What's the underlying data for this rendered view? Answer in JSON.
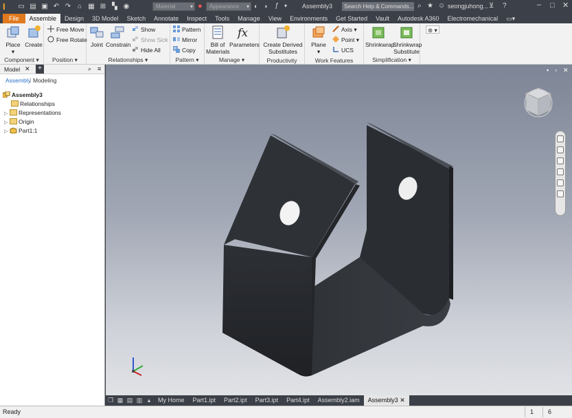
{
  "titlebar": {
    "material_placeholder": "Material",
    "appearance_placeholder": "Appearance",
    "document_title": "Assembly3",
    "search_placeholder": "Search Help & Commands...",
    "user": "seongjuhong..."
  },
  "tabs": [
    "File",
    "Assemble",
    "Design",
    "3D Model",
    "Sketch",
    "Annotate",
    "Inspect",
    "Tools",
    "Manage",
    "View",
    "Environments",
    "Get Started",
    "Vault",
    "Autodesk A360",
    "Electromechanical"
  ],
  "ribbon": {
    "component": {
      "place": "Place",
      "create": "Create",
      "label": "Component"
    },
    "position": {
      "free_move": "Free Move",
      "free_rotate": "Free Rotate",
      "label": "Position"
    },
    "relationships": {
      "joint": "Joint",
      "constrain": "Constrain",
      "show": "Show",
      "show_sick": "Show Sick",
      "hide_all": "Hide All",
      "label": "Relationships"
    },
    "pattern": {
      "pattern": "Pattern",
      "mirror": "Mirror",
      "copy": "Copy",
      "label": "Pattern"
    },
    "manage": {
      "bom_line1": "Bill of",
      "bom_line2": "Materials",
      "parameters": "Parameters",
      "label": "Manage"
    },
    "productivity": {
      "line1": "Create Derived",
      "line2": "Substitutes",
      "label": "Productivity"
    },
    "work_features": {
      "plane": "Plane",
      "axis": "Axis",
      "point": "Point",
      "ucs": "UCS",
      "label": "Work Features"
    },
    "simplification": {
      "shrinkwrap": "Shrinkwrap",
      "sw_sub_line1": "Shrinkwrap",
      "sw_sub_line2": "Substitute",
      "label": "Simplification"
    }
  },
  "browser": {
    "tab": "Model",
    "mode_assembly": "Assembly",
    "mode_modeling": "Modeling",
    "tree": [
      "Assembly3",
      "Relationships",
      "Representations",
      "Origin",
      "Part1:1"
    ]
  },
  "doctabs": [
    "My Home",
    "Part1.ipt",
    "Part2.ipt",
    "Part3.ipt",
    "Part4.ipt",
    "Assembly2.iam",
    "Assembly3"
  ],
  "status": {
    "text": "Ready",
    "n1": "1",
    "n2": "6"
  },
  "colors": {
    "file_tab": "#e07a1f",
    "accent": "#2a72c8",
    "part": "#2b2e33"
  }
}
